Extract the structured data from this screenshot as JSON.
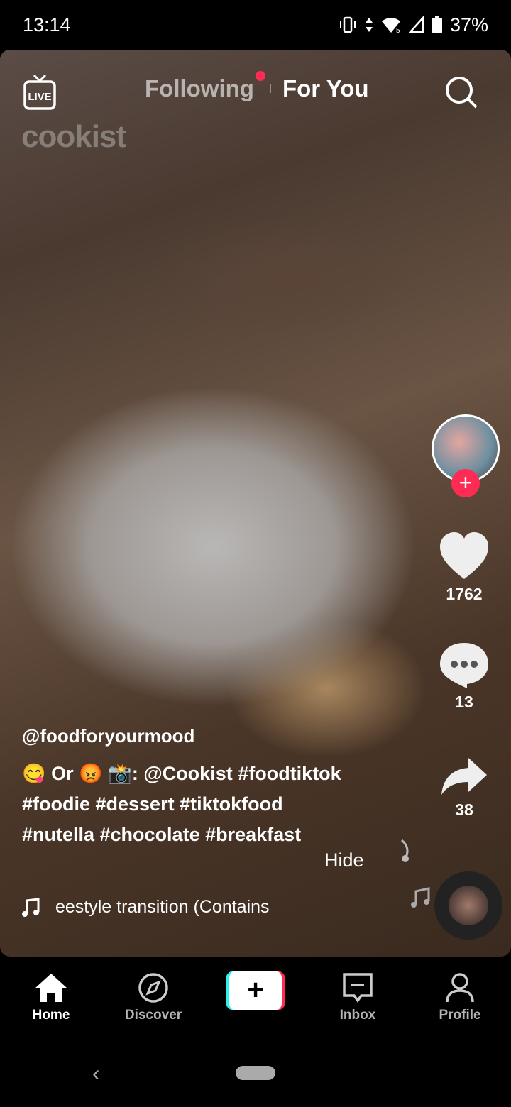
{
  "status": {
    "time": "13:14",
    "battery": "37%"
  },
  "header": {
    "live_label": "LIVE",
    "tabs": [
      {
        "label": "Following",
        "has_dot": true
      },
      {
        "label": "For You",
        "active": true
      }
    ]
  },
  "video": {
    "watermark": "cookist",
    "author": "@foodforyourmood",
    "caption_lines": [
      "😋 Or 😡 📸: @Cookist #foodtiktok",
      "#foodie #dessert #tiktokfood",
      "#nutella #chocolate #breakfast"
    ],
    "hide_label": "Hide",
    "music": "eestyle transition (Contains"
  },
  "actions": {
    "likes": "1762",
    "comments": "13",
    "shares": "38"
  },
  "colors": {
    "accent": "#fe2c55",
    "cyan": "#25f4ee"
  },
  "nav": [
    {
      "label": "Home",
      "icon": "home-icon"
    },
    {
      "label": "Discover",
      "icon": "compass-icon"
    },
    {
      "label": "",
      "icon": "plus-icon"
    },
    {
      "label": "Inbox",
      "icon": "inbox-icon"
    },
    {
      "label": "Profile",
      "icon": "person-icon"
    }
  ]
}
